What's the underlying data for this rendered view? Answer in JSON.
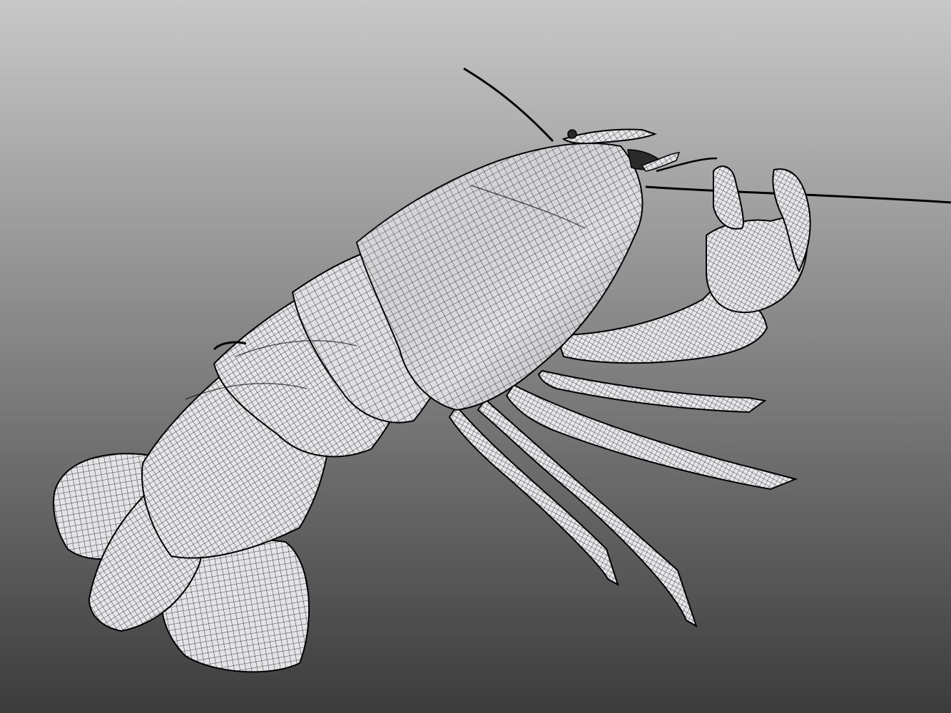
{
  "viewport": {
    "background": {
      "top_color": "#c8c8c8",
      "bottom_color": "#3c3c3c"
    },
    "shading": "wireframe-on-shaded"
  },
  "model": {
    "subject": "crayfish",
    "surface_color": "#e6e6ea",
    "wire_color": "#111111",
    "outline_color": "#000000",
    "parts": [
      "antenna-left",
      "antenna-right",
      "rostrum",
      "carapace",
      "abdomen",
      "tail-fan",
      "claw",
      "walking-legs"
    ]
  }
}
